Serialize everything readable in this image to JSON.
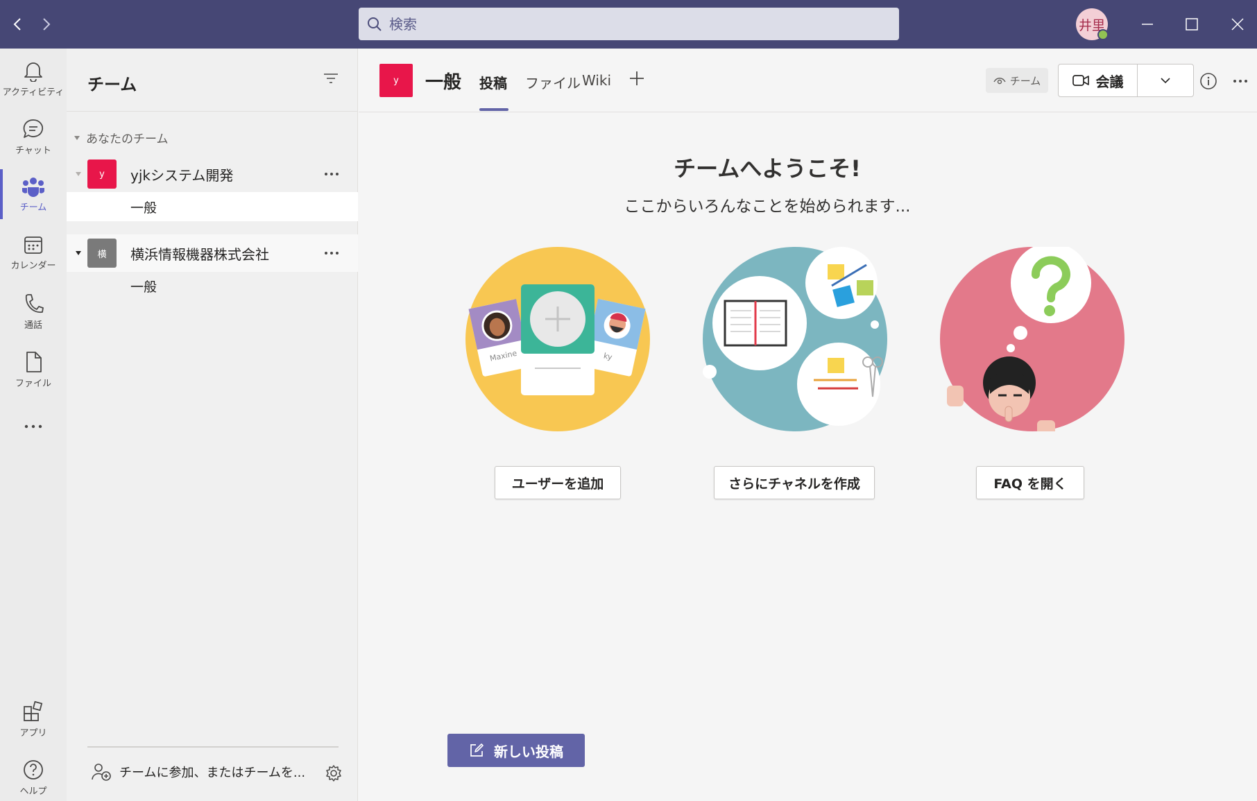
{
  "titlebar": {
    "search_placeholder": "検索",
    "avatar_initials": "井里",
    "colors": {
      "bar": "#464775",
      "presence": "#92c353"
    }
  },
  "rail": {
    "items": [
      {
        "label": "アクティビティ",
        "icon": "bell-icon"
      },
      {
        "label": "チャット",
        "icon": "chat-icon"
      },
      {
        "label": "チーム",
        "icon": "teams-icon",
        "active": true
      },
      {
        "label": "カレンダー",
        "icon": "calendar-icon"
      },
      {
        "label": "通話",
        "icon": "phone-icon"
      },
      {
        "label": "ファイル",
        "icon": "file-icon"
      },
      {
        "label": "",
        "icon": "more-apps-icon"
      }
    ],
    "bottom_items": [
      {
        "label": "アプリ",
        "icon": "apps-icon"
      },
      {
        "label": "ヘルプ",
        "icon": "help-icon"
      }
    ]
  },
  "teams_panel": {
    "title": "チーム",
    "section_label": "あなたのチーム",
    "teams": [
      {
        "tile_letter": "y",
        "tile_color": "#e8164a",
        "name": "yjkシステム開発",
        "channels": [
          "一般"
        ]
      },
      {
        "tile_letter": "横",
        "tile_color": "#7a7a7a",
        "name": "横浜情報機器株式会社",
        "channels": [
          "一般"
        ]
      }
    ],
    "join_label": "チームに参加、またはチームを..."
  },
  "channel_header": {
    "tile_letter": "y",
    "channel_name": "一般",
    "tabs": [
      "投稿",
      "ファイル",
      "Wiki"
    ],
    "active_tab": "投稿",
    "team_chip": "チーム",
    "meet_label": "会議"
  },
  "welcome": {
    "title": "チームへようこそ!",
    "subtitle": "ここからいろんなことを始められます...",
    "actions": [
      {
        "label": "ユーザーを追加",
        "illustration_color": "#f8c752"
      },
      {
        "label": "さらにチャネルを作成",
        "illustration_color": "#7cb6c0"
      },
      {
        "label": "FAQ を開く",
        "illustration_color": "#e3798a"
      }
    ],
    "card_names": [
      "Maxine",
      "ky"
    ]
  },
  "compose": {
    "new_post_label": "新しい投稿"
  }
}
